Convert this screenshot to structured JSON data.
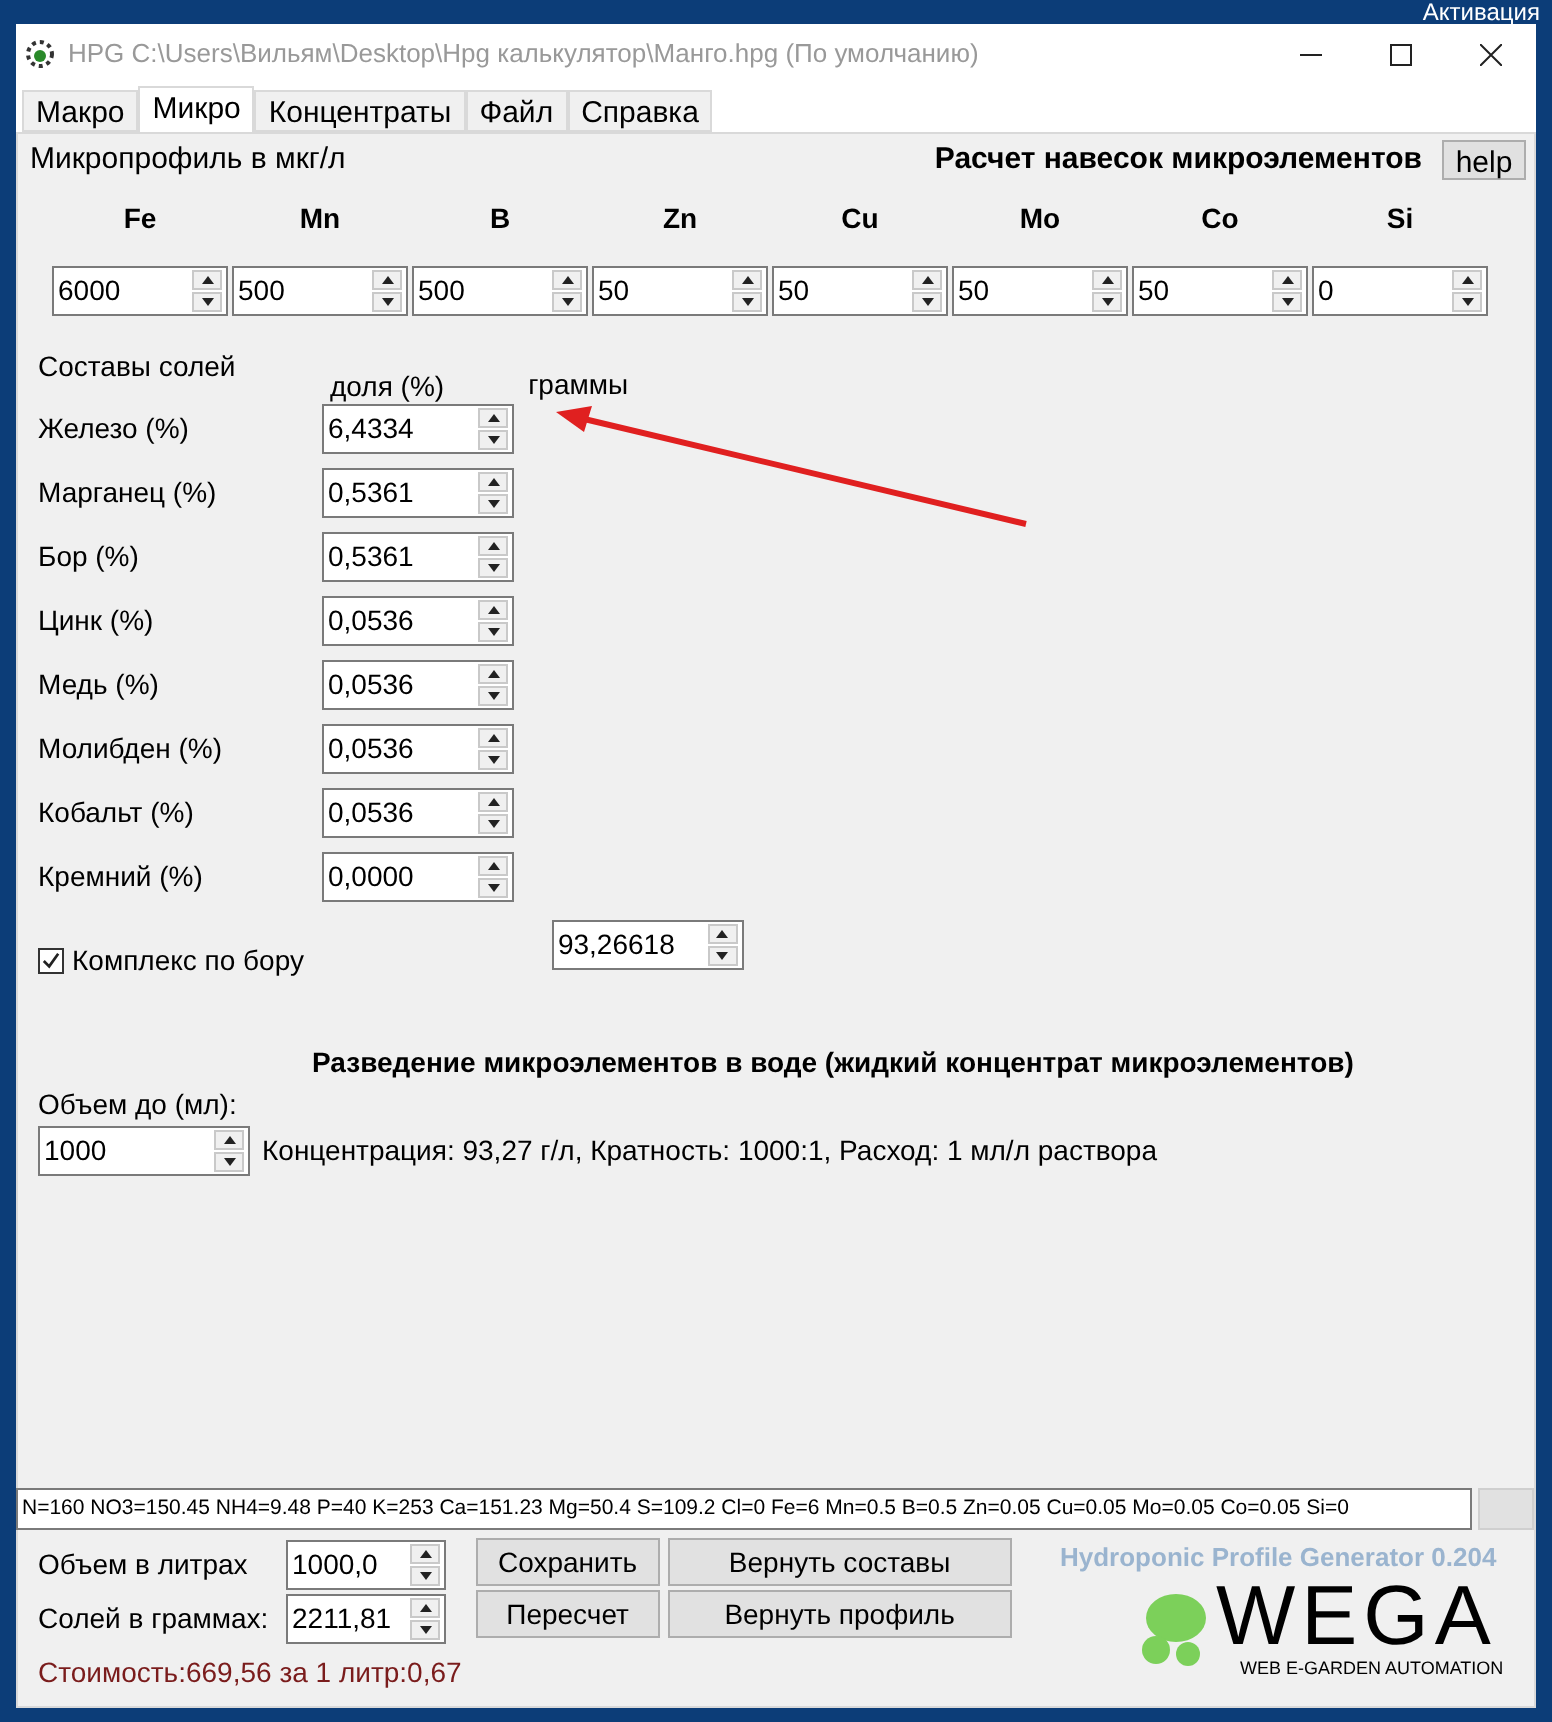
{
  "desktop_text": "Активация",
  "window": {
    "title": "HPG C:\\Users\\Вильям\\Desktop\\Hpg калькулятор\\Манго.hpg (По умолчанию)"
  },
  "tabs": [
    {
      "label": "Макро",
      "selected": false
    },
    {
      "label": "Микро",
      "selected": true
    },
    {
      "label": "Концентраты",
      "selected": false
    },
    {
      "label": "Файл",
      "selected": false
    },
    {
      "label": "Справка",
      "selected": false
    }
  ],
  "micro_profile": {
    "title": "Микропрофиль в мкг/л",
    "calc_title": "Расчет навесок микроэлементов",
    "help_button": "help",
    "elements": [
      {
        "symbol": "Fe",
        "value": "6000"
      },
      {
        "symbol": "Mn",
        "value": "500"
      },
      {
        "symbol": "B",
        "value": "500"
      },
      {
        "symbol": "Zn",
        "value": "50"
      },
      {
        "symbol": "Cu",
        "value": "50"
      },
      {
        "symbol": "Mo",
        "value": "50"
      },
      {
        "symbol": "Co",
        "value": "50"
      },
      {
        "symbol": "Si",
        "value": "0"
      }
    ]
  },
  "salts": {
    "title": "Составы солей",
    "share_header": "доля (%)",
    "grams_header": "граммы",
    "rows": [
      {
        "label": "Железо (%)",
        "value": "6,4334"
      },
      {
        "label": "Марганец (%)",
        "value": "0,5361"
      },
      {
        "label": "Бор (%)",
        "value": "0,5361"
      },
      {
        "label": "Цинк (%)",
        "value": "0,0536"
      },
      {
        "label": "Медь (%)",
        "value": "0,0536"
      },
      {
        "label": "Молибден (%)",
        "value": "0,0536"
      },
      {
        "label": "Кобальт (%)",
        "value": "0,0536"
      },
      {
        "label": "Кремний (%)",
        "value": "0,0000"
      }
    ]
  },
  "boron_complex": {
    "label": "Комплекс по бору",
    "checked": true,
    "value": "93,26618"
  },
  "dilution": {
    "title": "Разведение микроэлементов в воде (жидкий концентрат микроэлементов)",
    "volume_label": "Объем до (мл):",
    "volume_value": "1000",
    "info": "Концентрация: 93,27 г/л, Кратность: 1000:1, Расход: 1 мл/л раствора"
  },
  "status_text": "N=160 NO3=150.45 NH4=9.48 P=40 K=253 Ca=151.23 Mg=50.4 S=109.2 Cl=0 Fe=6 Mn=0.5 B=0.5 Zn=0.05 Cu=0.05 Mo=0.05 Co=0.05 Si=0",
  "bottom": {
    "volume_label": "Объем в литрах",
    "volume_value": "1000,0",
    "salts_label": "Солей в граммах:",
    "salts_value": "2211,81",
    "buttons": [
      "Сохранить",
      "Вернуть составы",
      "Пересчет",
      "Вернуть профиль"
    ],
    "cost": "Стоимость:669,56 за 1 литр:0,67"
  },
  "logo": {
    "caption": "Hydroponic Profile Generator 0.204",
    "name": "WEGA",
    "tagline": "WEB E-GARDEN AUTOMATION"
  }
}
